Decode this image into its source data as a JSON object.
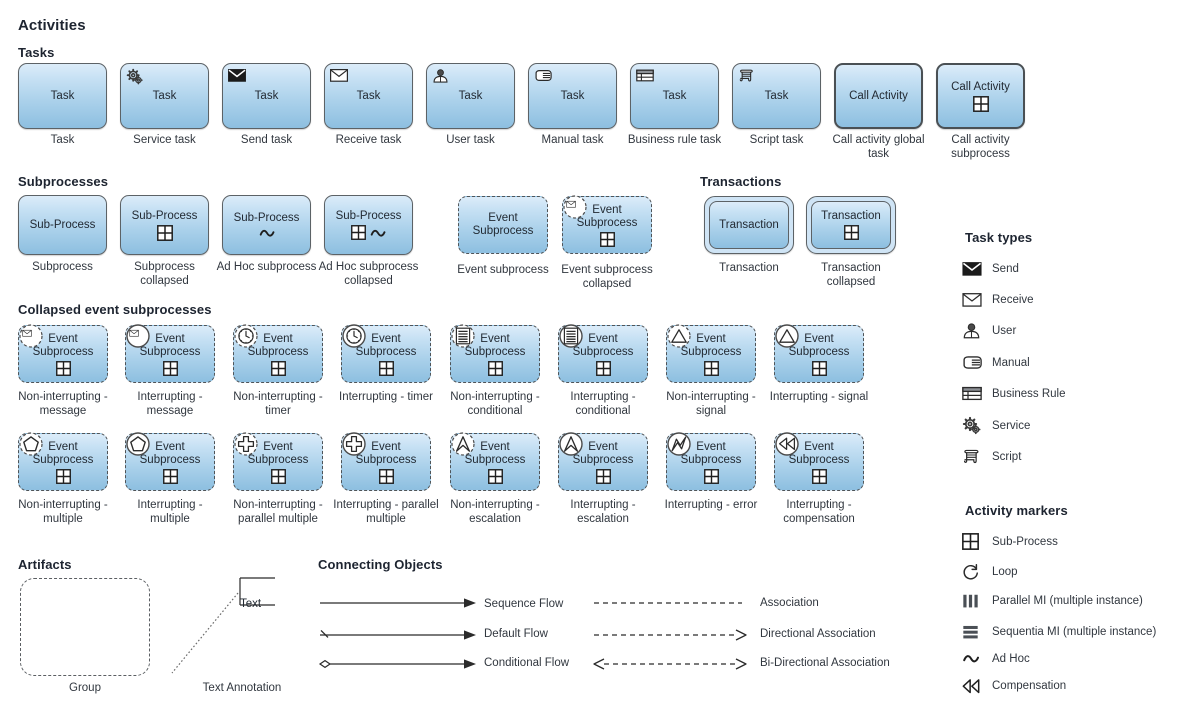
{
  "sections": {
    "activities": "Activities",
    "tasks": "Tasks",
    "subprocesses": "Subprocesses",
    "transactions": "Transactions",
    "collapsed_event_subprocesses": "Collapsed event subprocesses",
    "artifacts": "Artifacts",
    "connecting_objects": "Connecting Objects",
    "task_types": "Task types",
    "activity_markers": "Activity markers"
  },
  "colors": {
    "shape_fill_top": "#dcecf9",
    "shape_fill_bottom": "#8dbfe0",
    "shape_border": "#5c6266",
    "heading": "#1d2430",
    "caption": "#31373f"
  },
  "tasks": [
    {
      "box_label": "Task",
      "caption": "Task",
      "icon": "none"
    },
    {
      "box_label": "Task",
      "caption": "Service task",
      "icon": "gear-icon"
    },
    {
      "box_label": "Task",
      "caption": "Send task",
      "icon": "envelope-filled-icon"
    },
    {
      "box_label": "Task",
      "caption": "Receive task",
      "icon": "envelope-outline-icon"
    },
    {
      "box_label": "Task",
      "caption": "User task",
      "icon": "user-icon"
    },
    {
      "box_label": "Task",
      "caption": "Manual task",
      "icon": "hand-icon"
    },
    {
      "box_label": "Task",
      "caption": "Business rule task",
      "icon": "table-icon"
    },
    {
      "box_label": "Task",
      "caption": "Script task",
      "icon": "script-icon"
    },
    {
      "box_label": "Call Activity",
      "caption": "Call activity global task",
      "icon": "none",
      "thick": true
    },
    {
      "box_label": "Call Activity",
      "caption": "Call activity subprocess",
      "icon": "none",
      "thick": true,
      "marker": "subprocess-marker"
    }
  ],
  "subprocesses": [
    {
      "box_label": "Sub-Process",
      "caption": "Subprocess",
      "marker": "none"
    },
    {
      "box_label": "Sub-Process",
      "caption": "Subprocess collapsed",
      "marker": "subprocess-marker"
    },
    {
      "box_label": "Sub-Process",
      "caption": "Ad Hoc subprocess",
      "marker": "adhoc-marker"
    },
    {
      "box_label": "Sub-Process",
      "caption": "Ad Hoc subprocess collapsed",
      "marker": "subprocess-adhoc-marker"
    }
  ],
  "event_subprocesses": [
    {
      "box_label": "Event Subprocess",
      "caption": "Event subprocess",
      "badge": "none",
      "marker": "none"
    },
    {
      "box_label": "Event Subprocess",
      "caption": "Event subprocess collapsed",
      "badge": "message-noninterrupting-icon",
      "marker": "subprocess-marker"
    }
  ],
  "transactions": [
    {
      "box_label": "Transaction",
      "caption": "Transaction",
      "marker": "none"
    },
    {
      "box_label": "Transaction",
      "caption": "Transaction collapsed",
      "marker": "subprocess-marker"
    }
  ],
  "collapsed_event_subprocesses": [
    {
      "box_label": "Event Subprocess",
      "caption": "Non-interrupting - message",
      "badge": "message-noninterrupting-icon"
    },
    {
      "box_label": "Event Subprocess",
      "caption": "Interrupting - message",
      "badge": "message-interrupting-icon"
    },
    {
      "box_label": "Event Subprocess",
      "caption": "Non-interrupting - timer",
      "badge": "timer-noninterrupting-icon"
    },
    {
      "box_label": "Event Subprocess",
      "caption": "Interrupting - timer",
      "badge": "timer-interrupting-icon"
    },
    {
      "box_label": "Event Subprocess",
      "caption": "Non-interrupting - conditional",
      "badge": "conditional-noninterrupting-icon"
    },
    {
      "box_label": "Event Subprocess",
      "caption": "Interrupting - conditional",
      "badge": "conditional-interrupting-icon"
    },
    {
      "box_label": "Event Subprocess",
      "caption": "Non-interrupting - signal",
      "badge": "signal-noninterrupting-icon"
    },
    {
      "box_label": "Event Subprocess",
      "caption": "Interrupting  - signal",
      "badge": "signal-interrupting-icon"
    },
    {
      "box_label": "Event Subprocess",
      "caption": "Non-interrupting - multiple",
      "badge": "multiple-noninterrupting-icon"
    },
    {
      "box_label": "Event Subprocess",
      "caption": "Interrupting - multiple",
      "badge": "multiple-interrupting-icon"
    },
    {
      "box_label": "Event Subprocess",
      "caption": "Non-interrupting - parallel multiple",
      "badge": "parallel-multiple-noninterrupting-icon"
    },
    {
      "box_label": "Event Subprocess",
      "caption": "Interrupting - parallel multiple",
      "badge": "parallel-multiple-interrupting-icon"
    },
    {
      "box_label": "Event Subprocess",
      "caption": "Non-interrupting - escalation",
      "badge": "escalation-noninterrupting-icon"
    },
    {
      "box_label": "Event Subprocess",
      "caption": "Interrupting - escalation",
      "badge": "escalation-interrupting-icon"
    },
    {
      "box_label": "Event Subprocess",
      "caption": "Interrupting - error",
      "badge": "error-interrupting-icon"
    },
    {
      "box_label": "Event Subprocess",
      "caption": "Interrupting - compensation",
      "badge": "compensation-interrupting-icon"
    }
  ],
  "artifacts": [
    {
      "caption": "Group",
      "kind": "group"
    },
    {
      "caption": "Text Annotation",
      "kind": "text-annotation",
      "text": "Text"
    }
  ],
  "connecting_objects": {
    "left": [
      {
        "label": "Sequence Flow",
        "kind": "sequence-flow"
      },
      {
        "label": "Default Flow",
        "kind": "default-flow"
      },
      {
        "label": "Conditional Flow",
        "kind": "conditional-flow"
      }
    ],
    "right": [
      {
        "label": "Association",
        "kind": "association"
      },
      {
        "label": "Directional Association",
        "kind": "directional-association"
      },
      {
        "label": "Bi-Directional Association",
        "kind": "bidirectional-association"
      }
    ]
  },
  "task_types": [
    {
      "label": "Send",
      "icon": "envelope-filled-icon"
    },
    {
      "label": "Receive",
      "icon": "envelope-outline-icon"
    },
    {
      "label": "User",
      "icon": "user-icon"
    },
    {
      "label": "Manual",
      "icon": "hand-icon"
    },
    {
      "label": "Business Rule",
      "icon": "table-icon"
    },
    {
      "label": "Service",
      "icon": "gear-icon"
    },
    {
      "label": "Script",
      "icon": "script-icon"
    }
  ],
  "activity_markers": [
    {
      "label": "Sub-Process",
      "icon": "subprocess-marker-icon"
    },
    {
      "label": "Loop",
      "icon": "loop-marker-icon"
    },
    {
      "label": "Parallel MI (multiple instance)",
      "icon": "parallel-mi-marker-icon"
    },
    {
      "label": "Sequentia MI (multiple instance)",
      "icon": "sequential-mi-marker-icon"
    },
    {
      "label": "Ad Hoc",
      "icon": "adhoc-marker-icon"
    },
    {
      "label": "Compensation",
      "icon": "compensation-marker-icon"
    }
  ]
}
